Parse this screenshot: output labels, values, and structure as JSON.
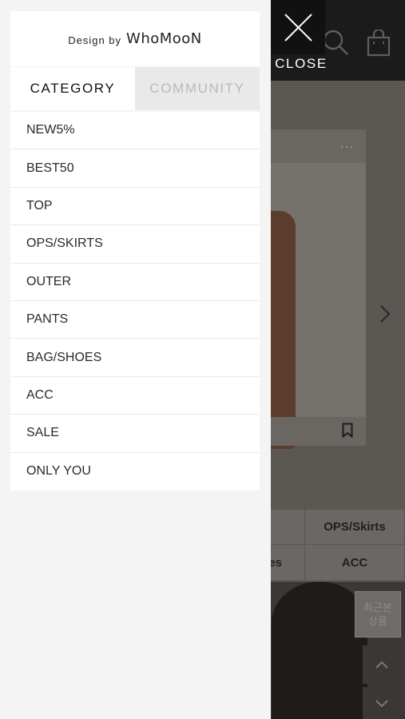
{
  "brand": {
    "prefix": "Design by",
    "name": "WhoMooN"
  },
  "close_button": {
    "label": "CLOSE",
    "icon": "close-icon"
  },
  "tabs": [
    {
      "label": "CATEGORY",
      "active": true
    },
    {
      "label": "COMMUNITY",
      "active": false
    }
  ],
  "categories": [
    {
      "label": "NEW5%"
    },
    {
      "label": "BEST50"
    },
    {
      "label": "TOP"
    },
    {
      "label": "OPS/SKIRTS"
    },
    {
      "label": "OUTER"
    },
    {
      "label": "PANTS"
    },
    {
      "label": "BAG/SHOES"
    },
    {
      "label": "ACC"
    },
    {
      "label": "SALE"
    },
    {
      "label": "ONLY YOU"
    }
  ],
  "background": {
    "header_icons": [
      "search-icon",
      "shopping-bag-icon"
    ],
    "product_card": {
      "more_icon": "···",
      "bookmark_icon": "bookmark-icon"
    },
    "category_grid": [
      "OPS/Skirts",
      "es",
      "ACC"
    ],
    "recent_button": {
      "line1": "최근본",
      "line2": "상품"
    }
  },
  "colors": {
    "overlay_dark": "#1b1b1b",
    "drawer_bg": "#f4f4f4",
    "tab_inactive": "#e9e9e9",
    "text_muted": "#b9b9b9"
  }
}
